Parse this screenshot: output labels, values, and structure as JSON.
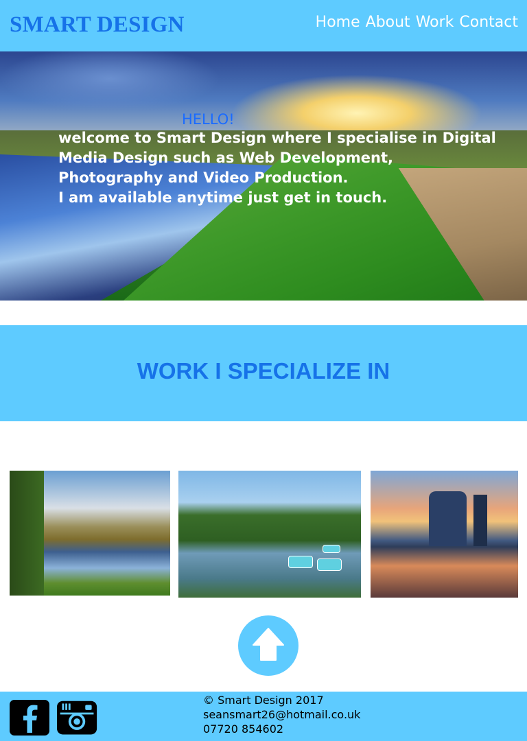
{
  "header": {
    "brand": "SMART DESIGN",
    "nav": [
      "Home",
      "About",
      "Work",
      "Contact"
    ],
    "bg_color": "#5ecbff",
    "brand_color": "#1672e8"
  },
  "hero": {
    "greeting": "HELLO!",
    "message": "welcome to Smart Design where I specialise in Digital\nMedia Design such as Web Development,\nPhotography and Video Production.\nI am available anytime just get in touch."
  },
  "work_section": {
    "title": "WORK I SPECIALIZE IN"
  },
  "back_to_top": {
    "icon": "up-arrow-icon"
  },
  "footer": {
    "copyright": "© Smart Design 2017",
    "email": "seansmart26@hotmail.co.uk",
    "phone": "07720 854602",
    "social": [
      "facebook-icon",
      "instagram-icon"
    ]
  }
}
